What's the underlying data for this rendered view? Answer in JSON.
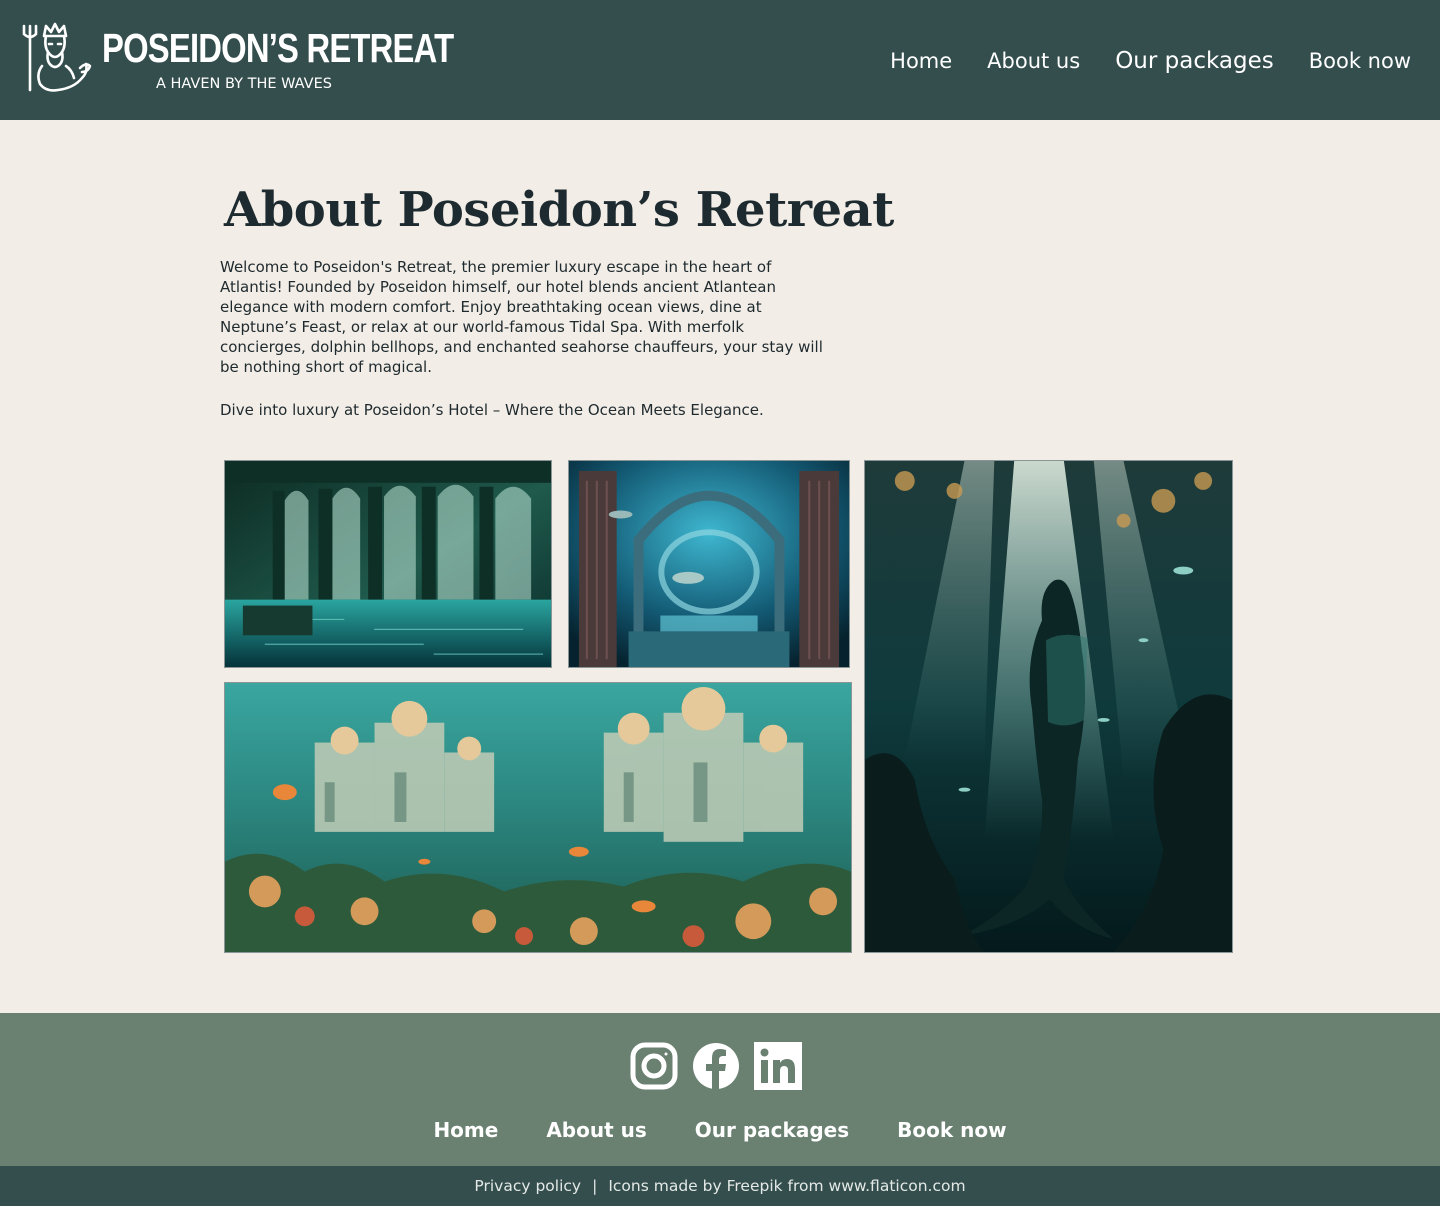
{
  "header": {
    "brand_title": "POSEIDON’S RETREAT",
    "brand_tagline": "A HAVEN BY THE WAVES",
    "logo_icon": "poseidon-trident-logo-icon",
    "nav": [
      {
        "label": "Home"
      },
      {
        "label": "About us"
      },
      {
        "label": "Our packages"
      },
      {
        "label": "Book now"
      }
    ]
  },
  "main": {
    "heading": "About Poseidon’s Retreat",
    "intro": "Welcome to Poseidon's Retreat, the premier luxury escape in the heart of Atlantis! Founded by Poseidon himself, our hotel blends ancient Atlantean elegance with modern comfort. Enjoy breathtaking ocean views, dine at Neptune’s Feast, or relax at our world-famous Tidal Spa. With merfolk concierges, dolphin bellhops, and enchanted seahorse chauffeurs, your stay will be nothing short of magical.",
    "tagline": "Dive into luxury at Poseidon’s Hotel – Where the Ocean Meets Elegance.",
    "gallery": [
      {
        "subject": "underwater-colonnade-hall"
      },
      {
        "subject": "sunken-arch-with-columns-and-fish"
      },
      {
        "subject": "mermaid-in-sunbeams"
      },
      {
        "subject": "underwater-domed-city-with-coral-reef"
      }
    ]
  },
  "footer": {
    "social_icons": [
      "instagram-icon",
      "facebook-icon",
      "linkedin-icon"
    ],
    "nav": [
      {
        "label": "Home"
      },
      {
        "label": "About us"
      },
      {
        "label": "Our packages"
      },
      {
        "label": "Book now"
      }
    ],
    "legal": {
      "privacy_label": "Privacy policy",
      "separator": "|",
      "credit": "Icons made by Freepik from www.flaticon.com"
    }
  },
  "colors": {
    "header_bg": "#344d4d",
    "page_bg": "#f2ede7",
    "footer_bg": "#6a8171",
    "legal_bg": "#344d4d"
  }
}
